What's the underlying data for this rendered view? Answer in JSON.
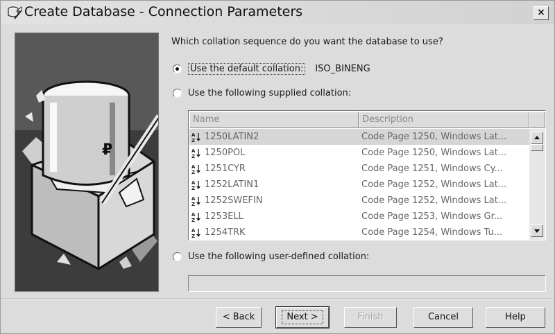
{
  "window": {
    "title": "Create Database - Connection Parameters",
    "close_label": "×"
  },
  "prompt": {
    "question": "Which collation sequence do you want the database to use?"
  },
  "options": {
    "default": {
      "label": "Use the default collation:",
      "value": "ISO_BINENG",
      "checked": true
    },
    "supplied": {
      "label": "Use the following supplied collation:",
      "checked": false
    },
    "user_defined": {
      "label": "Use the following user-defined collation:",
      "checked": false,
      "value": ""
    }
  },
  "collation_table": {
    "columns": {
      "name": "Name",
      "description": "Description"
    },
    "rows": [
      {
        "name": "1250LATIN2",
        "description": "Code Page 1250, Windows Lat...",
        "selected": true
      },
      {
        "name": "1250POL",
        "description": "Code Page 1250, Windows Lat..."
      },
      {
        "name": "1251CYR",
        "description": "Code Page 1251, Windows Cy..."
      },
      {
        "name": "1252LATIN1",
        "description": "Code Page 1252, Windows Lat..."
      },
      {
        "name": "1252SWEFIN",
        "description": "Code Page 1252, Windows Lat..."
      },
      {
        "name": "1253ELL",
        "description": "Code Page 1253, Windows Gr..."
      },
      {
        "name": "1254TRK",
        "description": "Code Page 1254, Windows Tu..."
      }
    ]
  },
  "buttons": {
    "back": "< Back",
    "next": "Next >",
    "finish": "Finish",
    "cancel": "Cancel",
    "help": "Help"
  },
  "icons": {
    "title": "database-wizard-icon",
    "sort": "sort-az-icon"
  },
  "colors": {
    "dialog_bg": "#dcdcdc",
    "selected_row": "#d6d6d6",
    "disabled_text": "#a0a0a0"
  }
}
